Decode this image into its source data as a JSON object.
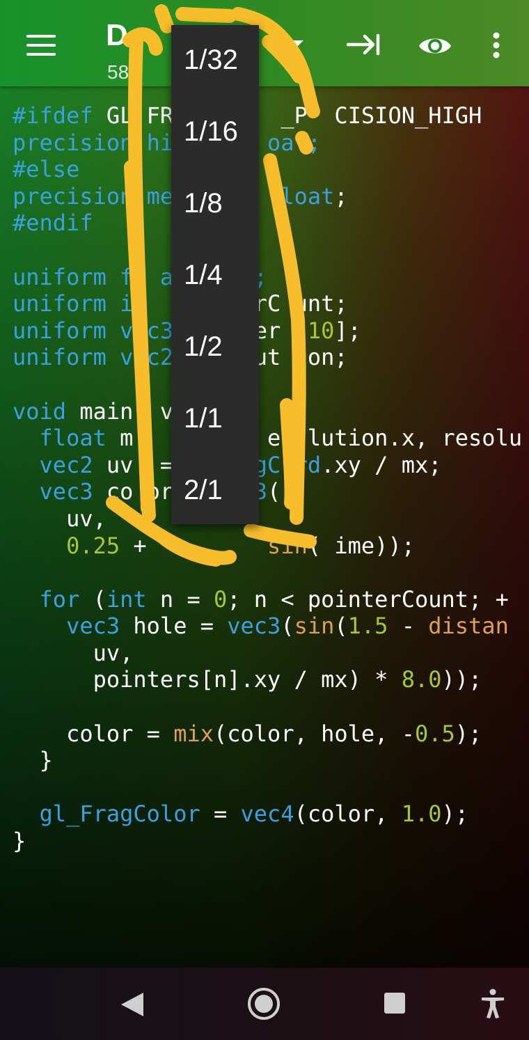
{
  "appbar": {
    "title": "D",
    "subtitle": "58"
  },
  "zoom_menu": {
    "options": [
      "1/32",
      "1/16",
      "1/8",
      "1/4",
      "1/2",
      "1/1",
      "2/1"
    ]
  },
  "code_lines": [
    [
      {
        "t": "#ifdef ",
        "c": "kw"
      },
      {
        "t": "GL FR        _P  CISION_HIGH",
        "c": ""
      }
    ],
    [
      {
        "t": "precision",
        "c": "kw"
      },
      {
        "t": " hi       oat;",
        "c": "kw"
      }
    ],
    [
      {
        "t": "#else",
        "c": "kw"
      }
    ],
    [
      {
        "t": "precision",
        "c": "kw"
      },
      {
        "t": " me       f",
        "c": "kw"
      },
      {
        "t": "l",
        "c": "kw"
      },
      {
        "t": "oat",
        "c": "kw"
      },
      {
        "t": ";",
        "c": ""
      }
    ],
    [
      {
        "t": "#endif",
        "c": "kw"
      }
    ],
    [
      {
        "t": "",
        "c": ""
      }
    ],
    [
      {
        "t": "uniform",
        "c": "kw"
      },
      {
        "t": " f  a      ;",
        "c": "kw"
      }
    ],
    [
      {
        "t": "uniform",
        "c": "kw"
      },
      {
        "t": " i         ",
        "c": "kw"
      },
      {
        "t": "rC unt;",
        "c": ""
      }
    ],
    [
      {
        "t": "uniform",
        "c": "kw"
      },
      {
        "t": " v c3      ",
        "c": "kw"
      },
      {
        "t": "er ",
        "c": ""
      },
      {
        "t": "[",
        "c": ""
      },
      {
        "t": "10",
        "c": "num"
      },
      {
        "t": "];",
        "c": ""
      }
    ],
    [
      {
        "t": "uniform",
        "c": "kw"
      },
      {
        "t": " v c2      ",
        "c": "kw"
      },
      {
        "t": "ut  on;",
        "c": ""
      }
    ],
    [
      {
        "t": "",
        "c": ""
      }
    ],
    [
      {
        "t": "void",
        "c": "kw"
      },
      {
        "t": " main  vo",
        "c": ""
      }
    ],
    [
      {
        "t": "  float",
        "c": "kw"
      },
      {
        "t": " m   =      es lution.x, resolu",
        "c": ""
      }
    ],
    [
      {
        "t": "  vec2",
        "c": "kw"
      },
      {
        "t": " uv  =      ",
        "c": ""
      },
      {
        "t": "gC rd",
        "c": "kw"
      },
      {
        "t": ".xy / mx;",
        "c": ""
      }
    ],
    [
      {
        "t": "  vec3",
        "c": "kw"
      },
      {
        "t": " co or      ",
        "c": ""
      },
      {
        "t": "3",
        "c": "kw"
      },
      {
        "t": "(",
        "c": ""
      }
    ],
    [
      {
        "t": "    uv,",
        "c": ""
      }
    ],
    [
      {
        "t": "    ",
        "c": ""
      },
      {
        "t": "0.25",
        "c": "num"
      },
      {
        "t": " +         ",
        "c": ""
      },
      {
        "t": "sin",
        "c": "fn"
      },
      {
        "t": "( ime));",
        "c": ""
      }
    ],
    [
      {
        "t": "",
        "c": ""
      }
    ],
    [
      {
        "t": "  for",
        "c": "kw"
      },
      {
        "t": " (",
        "c": ""
      },
      {
        "t": "int",
        "c": "kw"
      },
      {
        "t": " n = ",
        "c": ""
      },
      {
        "t": "0",
        "c": "num"
      },
      {
        "t": "; n < pointerCount; +",
        "c": ""
      }
    ],
    [
      {
        "t": "    vec3",
        "c": "kw"
      },
      {
        "t": " hole = ",
        "c": ""
      },
      {
        "t": "vec3",
        "c": "kw"
      },
      {
        "t": "(",
        "c": ""
      },
      {
        "t": "sin",
        "c": "fn"
      },
      {
        "t": "(",
        "c": ""
      },
      {
        "t": "1.5",
        "c": "num"
      },
      {
        "t": " - ",
        "c": ""
      },
      {
        "t": "distan",
        "c": "fn"
      }
    ],
    [
      {
        "t": "      uv,",
        "c": ""
      }
    ],
    [
      {
        "t": "      pointers[n].xy / mx) * ",
        "c": ""
      },
      {
        "t": "8.0",
        "c": "num"
      },
      {
        "t": "));",
        "c": ""
      }
    ],
    [
      {
        "t": "",
        "c": ""
      }
    ],
    [
      {
        "t": "    color = ",
        "c": ""
      },
      {
        "t": "mix",
        "c": "fn"
      },
      {
        "t": "(color, hole, -",
        "c": ""
      },
      {
        "t": "0.5",
        "c": "num"
      },
      {
        "t": ");",
        "c": ""
      }
    ],
    [
      {
        "t": "  }",
        "c": ""
      }
    ],
    [
      {
        "t": "",
        "c": ""
      }
    ],
    [
      {
        "t": "  gl_FragColor",
        "c": "kw"
      },
      {
        "t": " = ",
        "c": ""
      },
      {
        "t": "vec4",
        "c": "kw"
      },
      {
        "t": "(color, ",
        "c": ""
      },
      {
        "t": "1.0",
        "c": "num"
      },
      {
        "t": ");",
        "c": ""
      }
    ],
    [
      {
        "t": "}",
        "c": ""
      }
    ]
  ],
  "colors": {
    "keyword": "#3aa0e0",
    "function": "#e0a050",
    "number": "#a8c830",
    "popup_bg": "#2b2b2b",
    "scribble": "#f7bd2a"
  },
  "icons": {
    "menu": "hamburger-menu-icon",
    "dropdown": "dropdown-arrow-icon",
    "tab": "insert-tab-icon",
    "preview": "eye-icon",
    "more": "more-vertical-icon",
    "nav_back": "back-triangle-icon",
    "nav_home": "home-circle-icon",
    "nav_recents": "recents-square-icon",
    "nav_accessibility": "accessibility-icon"
  }
}
